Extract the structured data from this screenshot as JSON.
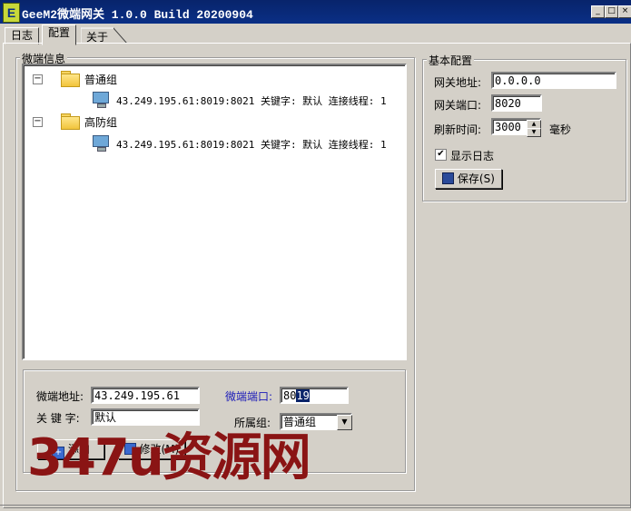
{
  "window": {
    "app_icon_letter": "E",
    "title": "GeeM2微端网关 1.0.0 Build 20200904"
  },
  "window_controls": {
    "minimize": "_",
    "maximize": "□",
    "close": "×"
  },
  "tabs": [
    {
      "label": "日志"
    },
    {
      "label": "配置"
    },
    {
      "label": "关于"
    }
  ],
  "active_tab": "配置",
  "client_group": {
    "legend": "微端信息",
    "tree": [
      {
        "group": "普通组",
        "expander": "−",
        "node": "43.249.195.61:8019:8021 关键字: 默认 连接线程: 1"
      },
      {
        "group": "高防组",
        "expander": "−",
        "node": "43.249.195.61:8019:8021 关键字: 默认 连接线程: 1"
      }
    ],
    "form": {
      "address_label": "微端地址:",
      "address_value": "43.249.195.61",
      "port_label": "微端端口:",
      "port_value_plain": "80",
      "port_value_selected": "19",
      "keyword_label": "关 键 字:",
      "keyword_value": "默认",
      "group_label": "所属组:",
      "group_value": "普通组",
      "add_button": "添加",
      "modify_button": "修改(M)"
    }
  },
  "basic_config": {
    "legend": "基本配置",
    "gateway_address_label": "网关地址:",
    "gateway_address_value": "0.0.0.0",
    "gateway_port_label": "网关端口:",
    "gateway_port_value": "8020",
    "refresh_label": "刷新时间:",
    "refresh_value": "3000",
    "refresh_unit": "毫秒",
    "show_log_label": "显示日志",
    "show_log_checked": true,
    "save_button": "保存(S)"
  },
  "watermark": "347u资源网",
  "colors": {
    "titlebar": "#0a2f86",
    "watermark": "#8a1414",
    "port_label": "#1a1ab8"
  }
}
